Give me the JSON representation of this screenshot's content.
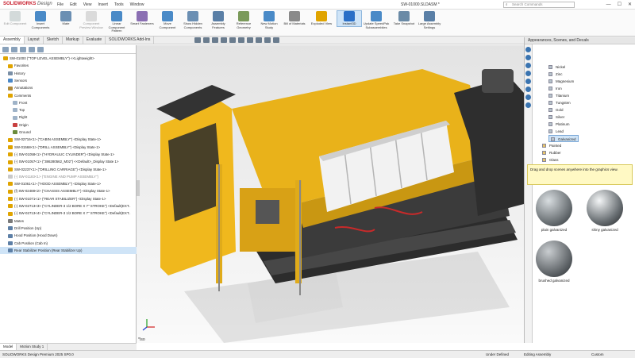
{
  "app": {
    "brand": "SOLIDWORKS",
    "brand_suffix": "Design",
    "doc_title": "SW-01000.SLDASM *",
    "search_placeholder": "Search Commands"
  },
  "menu": [
    "File",
    "Edit",
    "View",
    "Insert",
    "Tools",
    "Window"
  ],
  "ribbon": [
    {
      "label": "Edit Component",
      "disabled": true
    },
    {
      "label": "Insert Components",
      "disabled": false
    },
    {
      "label": "Mate",
      "disabled": false
    },
    {
      "label": "Component Preview Window",
      "disabled": true
    },
    {
      "label": "Linear Component Pattern",
      "disabled": false
    },
    {
      "label": "Smart Fasteners",
      "disabled": false
    },
    {
      "label": "Move Component",
      "disabled": false
    },
    {
      "label": "Show Hidden Components",
      "disabled": false
    },
    {
      "label": "Assembly Features",
      "disabled": false
    },
    {
      "label": "Reference Geometry",
      "disabled": false
    },
    {
      "label": "New Motion Study",
      "disabled": false
    },
    {
      "label": "Bill of Materials",
      "disabled": false
    },
    {
      "label": "Exploded View",
      "disabled": false
    },
    {
      "label": "Instant3D",
      "disabled": false,
      "active": true
    },
    {
      "label": "Update SpeedPak Subassemblies",
      "disabled": false
    },
    {
      "label": "Take Snapshot",
      "disabled": false
    },
    {
      "label": "Large Assembly Settings",
      "disabled": false
    }
  ],
  "tabs": [
    "Assembly",
    "Layout",
    "Sketch",
    "Markup",
    "Evaluate",
    "SOLIDWORKS Add-Ins"
  ],
  "tree": [
    {
      "text": "SW-01000 (\"TOP LEVEL ASSEMBLY\") <<Lightweight>",
      "indent": 0,
      "color": "#e0a400"
    },
    {
      "text": "Favorites",
      "indent": 1,
      "color": "#e0a400"
    },
    {
      "text": "History",
      "indent": 1,
      "color": "#7a8fa6"
    },
    {
      "text": "Sensors",
      "indent": 1,
      "color": "#4a88c7"
    },
    {
      "text": "Annotations",
      "indent": 1,
      "color": "#b08a3a"
    },
    {
      "text": "Comments",
      "indent": 1,
      "color": "#e0a400"
    },
    {
      "text": "Front",
      "indent": 2,
      "color": "#9fb3c8"
    },
    {
      "text": "Top",
      "indent": 2,
      "color": "#9fb3c8"
    },
    {
      "text": "Right",
      "indent": 2,
      "color": "#9fb3c8"
    },
    {
      "text": "Origin",
      "indent": 2,
      "color": "#c84040"
    },
    {
      "text": "Ground",
      "indent": 2,
      "color": "#6b8b3a"
    },
    {
      "text": "SW-02716<1> (\"CABIN ASSEMBLY\") <Display State-1>",
      "indent": 1,
      "color": "#e0a400"
    },
    {
      "text": "SW-01568<1> (\"DRILL ASSEMBLY\") <Display State-1>",
      "indent": 1,
      "color": "#e0a400"
    },
    {
      "text": "(-) SW-01058<1> (\"HYDRAULIC CYLINDER\") <Display State-1>",
      "indent": 1,
      "color": "#e0a400"
    },
    {
      "text": "(-) SW-01057<1> (\"386280562_M02\") <<Default>_Display State 1>",
      "indent": 1,
      "color": "#e0a400"
    },
    {
      "text": "SW-02237<1> (\"DRILLING CARRIAGE\") <Display State-1>",
      "indent": 1,
      "color": "#e0a400"
    },
    {
      "text": "(-) SW-01183<1> (\"ENGINE AND PUMP ASSEMBLY\")",
      "indent": 1,
      "color": "#c9c9c9",
      "grey": true
    },
    {
      "text": "SW-01061<1> (\"HOOD ASSEMBLY\") <Display State-1>",
      "indent": 1,
      "color": "#e0a400"
    },
    {
      "text": "(f) SW-02488<2> (\"CHASSIS ASSEMBLY\") <Display State-1>",
      "indent": 1,
      "color": "#e0a400"
    },
    {
      "text": "(-) SW-01071<1> (\"REAR STABILIZER\") <Display State-1>",
      "indent": 1,
      "color": "#e0a400"
    },
    {
      "text": "(-) SW-02713<3> (\"CYLINDER-3 1/2 BORE X 7\" STROKE\") <Default(EXT..",
      "indent": 1,
      "color": "#e0a400"
    },
    {
      "text": "(-) SW-02713<4> (\"CYLINDER-3 1/2 BORE X 7\" STROKE\") <Default(EXT..",
      "indent": 1,
      "color": "#e0a400"
    },
    {
      "text": "Mates",
      "indent": 1,
      "color": "#7a7a7a"
    },
    {
      "text": "Drill Position (Up)",
      "indent": 1,
      "color": "#5d7fa6"
    },
    {
      "text": "Hood Position (Hood Down)",
      "indent": 1,
      "color": "#5d7fa6"
    },
    {
      "text": "Cab Position (Cab In)",
      "indent": 1,
      "color": "#5d7fa6"
    },
    {
      "text": "Rear Stabilizer Position (Rear Stabilizer Up)",
      "indent": 1,
      "color": "#5d7fa6",
      "selected": true
    }
  ],
  "task_panel": {
    "title": "Appearances, Scenes, and Decals",
    "materials": [
      "Nickel",
      "Zinc",
      "Magnesium",
      "Iron",
      "Titanium",
      "Tungsten",
      "Gold",
      "Silver",
      "Platinum",
      "Lead",
      "Galvanized"
    ],
    "selected_material": "Galvanized",
    "folders": [
      "Painted",
      "Rubber",
      "Glass"
    ],
    "hint": "Drag and drop scenes anywhere into the graphics view.",
    "swatches": [
      "plain galvanized",
      "shiny galvanized",
      "brushed galvanized"
    ]
  },
  "view_label": "*Iso",
  "bottom_tabs": [
    "Model",
    "Motion Study 1"
  ],
  "status": {
    "left": "SOLIDWORKS Design Premium 2025 SP0.0",
    "under_defined": "Under Defined",
    "editing": "Editing Assembly",
    "custom": "Custom"
  }
}
